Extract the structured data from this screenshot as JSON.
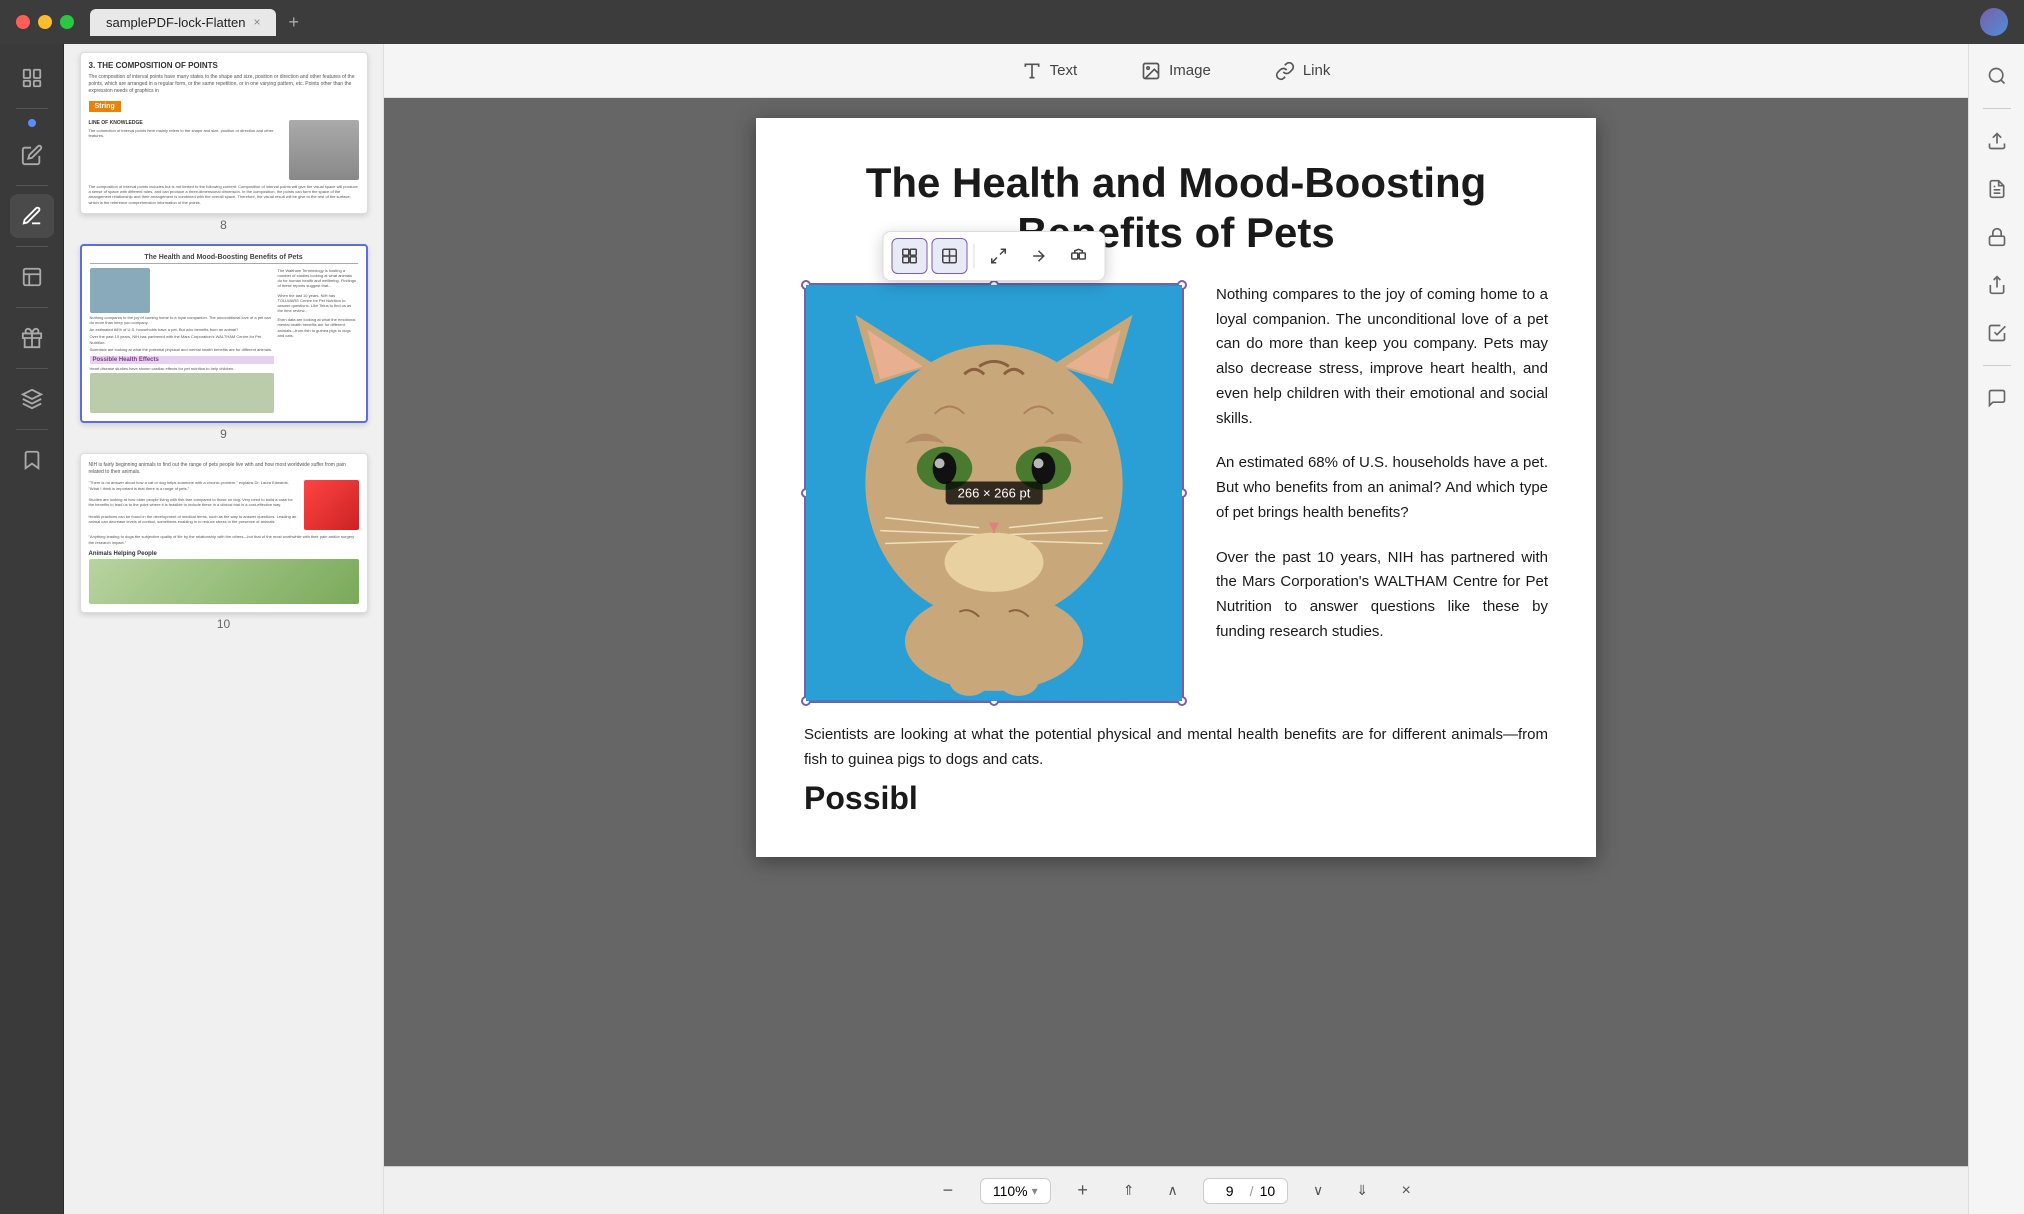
{
  "window": {
    "title": "samplePDF-lock-Flatten",
    "tab_close": "×",
    "tab_add": "+"
  },
  "toolbar": {
    "text_label": "Text",
    "image_label": "Image",
    "link_label": "Link"
  },
  "pdf": {
    "page_title": "The Health and Mood-Boosting Benefits of Pets",
    "paragraph1": "Nothing compares to the joy of coming home to a loyal companion. The unconditional love of a pet can do more than keep you company. Pets may also decrease stress, improve heart health, and even help children with their emotional and social skills.",
    "paragraph2": "An estimated 68% of U.S. households have a pet. But who benefits from an animal? And which type of pet brings health benefits?",
    "paragraph3": "Over the past 10 years, NIH has partnered with the Mars Corporation's WALTHAM Centre for Pet Nutrition to answer questions like these by funding research studies.",
    "bottom_text": "Scientists are looking at what the potential physical and mental health benefits are for different animals—from fish to guinea pigs to dogs and cats.",
    "section_heading": "Possibl",
    "image_dimensions": "266 × 266 pt"
  },
  "thumbnail": {
    "page8_num": "8",
    "page9_num": "9",
    "page10_num": "10",
    "page8_title": "3. THE COMPOSITION OF POINTS",
    "page9_title": "The Health and Mood-Boosting Benefits of Pets",
    "page9_section": "Possible Health Effects",
    "page8_badge": "String"
  },
  "image_toolbar": {
    "btn1": "⊡",
    "btn2": "⊞",
    "btn3": "⊠",
    "btn4": "→",
    "btn5": "⊞"
  },
  "zoom": {
    "level": "110%",
    "current_page": "9",
    "total_pages": "10"
  },
  "right_sidebar": {
    "search_icon": "search",
    "save_icon": "save",
    "pdf_icon": "pdf",
    "lock_icon": "lock",
    "share_icon": "share",
    "check_icon": "check"
  }
}
